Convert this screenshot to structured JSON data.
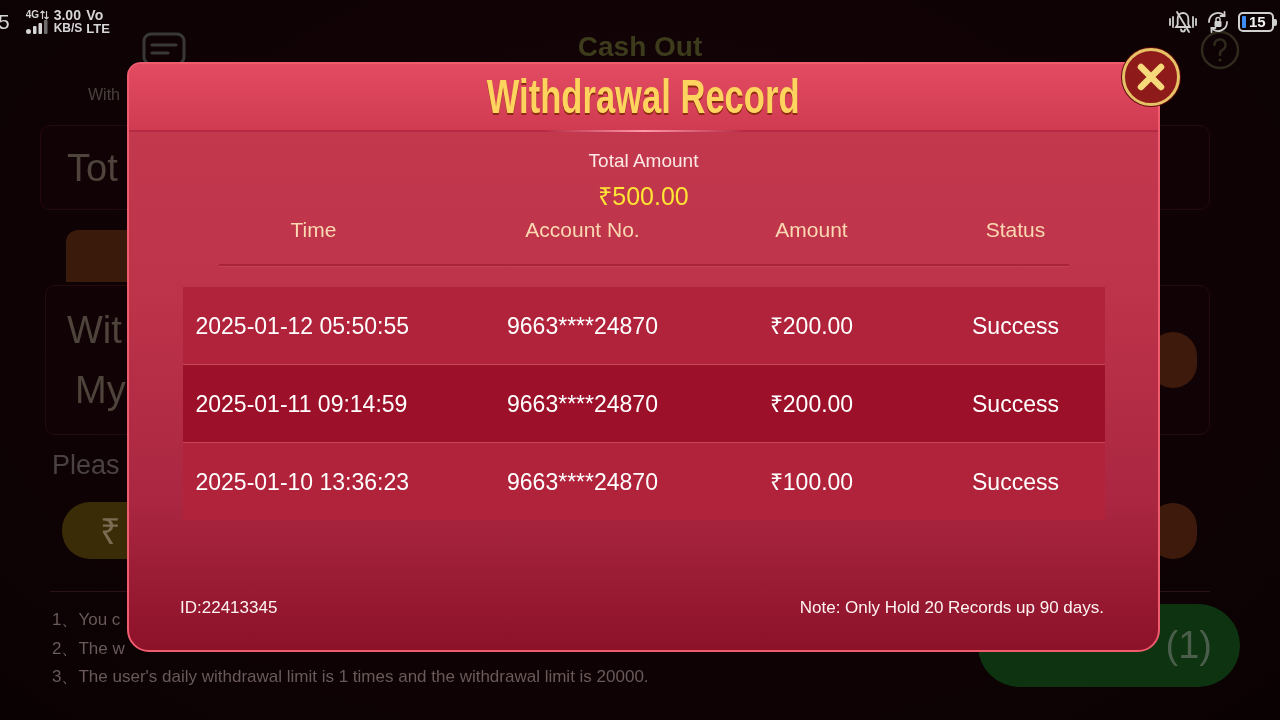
{
  "status_bar": {
    "clock_fragment": "5",
    "network": "4G",
    "speed": "3.00",
    "speed_unit": "KB/S",
    "volte": [
      "Vo",
      "LTE"
    ],
    "battery": "15"
  },
  "background_page": {
    "title": "Cash Out",
    "tab_label": "With",
    "total_label": "Tot",
    "withdraw_label": "Wit",
    "account_label": "My",
    "prompt": "Pleas",
    "amount_symbol": "₹",
    "notes": [
      "1、You c",
      "2、The w",
      "3、The user's daily withdrawal limit is 1 times and the withdrawal limit is 20000."
    ],
    "submit_label": "(1)"
  },
  "dialog": {
    "title": "Withdrawal Record",
    "total_label": "Total Amount",
    "total_value": "₹500.00",
    "columns": [
      "Time",
      "Account No.",
      "Amount",
      "Status"
    ],
    "rows": [
      {
        "time": "2025-01-12 05:50:55",
        "account": "9663****24870",
        "amount": "₹200.00",
        "status": "Success"
      },
      {
        "time": "2025-01-11 09:14:59",
        "account": "9663****24870",
        "amount": "₹200.00",
        "status": "Success"
      },
      {
        "time": "2025-01-10 13:36:23",
        "account": "9663****24870",
        "amount": "₹100.00",
        "status": "Success"
      }
    ],
    "user_id": "ID:22413345",
    "note": "Note: Only Hold 20 Records up 90 days."
  }
}
